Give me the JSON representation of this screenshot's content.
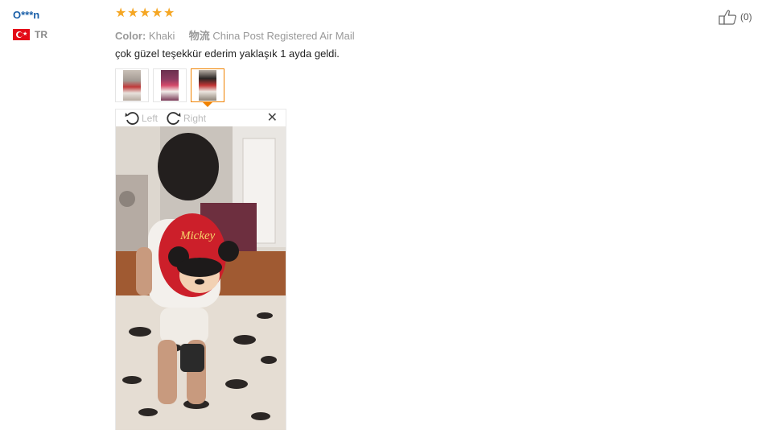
{
  "reviewer": {
    "name": "O***n",
    "country_code": "TR"
  },
  "rating": {
    "stars": 5,
    "max": 5,
    "color": "#f5a623"
  },
  "meta": {
    "color_label": "Color:",
    "color_value": "Khaki",
    "shipping_label": "物流",
    "shipping_value": "China Post Registered Air Mail"
  },
  "review": {
    "text": "çok güzel teşekkür ederim yaklaşık 1 ayda geldi."
  },
  "thumbnails": [
    {
      "alt": "photo-1"
    },
    {
      "alt": "photo-2"
    },
    {
      "alt": "photo-3",
      "selected": true
    }
  ],
  "viewer": {
    "rotate_left_label": "Left",
    "rotate_right_label": "Right",
    "close_icon": "close-icon"
  },
  "helpful": {
    "count_text": "(0)",
    "icon": "thumbs-up-icon"
  },
  "colors": {
    "username": "#1a5fa8",
    "accent": "#f08200"
  }
}
